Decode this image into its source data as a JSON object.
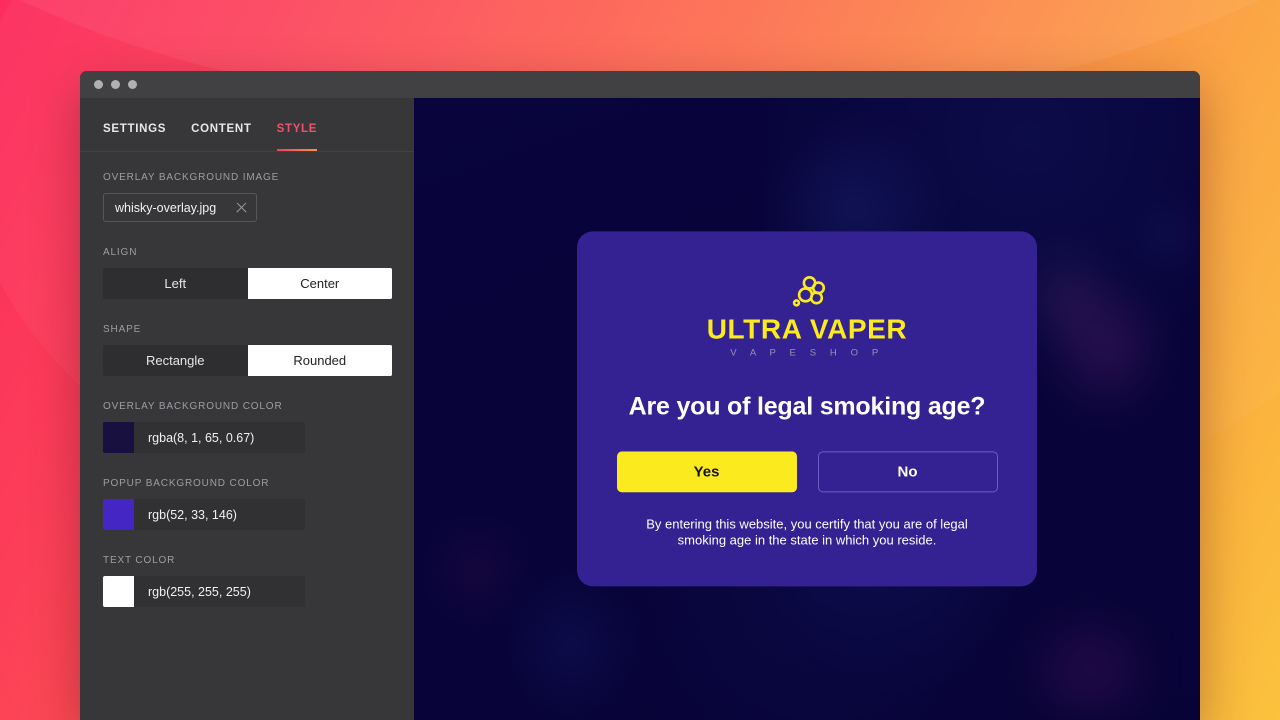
{
  "window": {
    "traffic_lights": [
      "close",
      "minimize",
      "maximize"
    ]
  },
  "editor": {
    "tabs": [
      {
        "label": "SETTINGS",
        "active": false
      },
      {
        "label": "CONTENT",
        "active": false
      },
      {
        "label": "STYLE",
        "active": true
      }
    ],
    "accent_color": "#f0516b",
    "fields": {
      "overlay_background_image": {
        "label": "OVERLAY BACKGROUND IMAGE",
        "value": "whisky-overlay.jpg",
        "clear_icon": "close-icon"
      },
      "align": {
        "label": "ALIGN",
        "options": [
          "Left",
          "Center"
        ],
        "selected": "Center"
      },
      "shape": {
        "label": "SHAPE",
        "options": [
          "Rectangle",
          "Rounded"
        ],
        "selected": "Rounded"
      },
      "overlay_background_color": {
        "label": "OVERLAY BACKGROUND COLOR",
        "value": "rgba(8, 1, 65, 0.67)",
        "swatch": "#18103f"
      },
      "popup_background_color": {
        "label": "POPUP BACKGROUND COLOR",
        "value": "rgb(52, 33, 146)",
        "swatch": "#342192"
      },
      "text_color": {
        "label": "TEXT COLOR",
        "value": "rgb(255, 255, 255)",
        "swatch": "#ffffff"
      }
    }
  },
  "preview": {
    "popup": {
      "logo": {
        "icon": "smoke-cloud-icon",
        "title": "ULTRA VAPER",
        "subtitle": "V A P E S H O P",
        "title_color": "#FBEB1E",
        "subtitle_color": "#9a93b5"
      },
      "heading": "Are you of legal smoking age?",
      "buttons": [
        {
          "label": "Yes",
          "style": "primary"
        },
        {
          "label": "No",
          "style": "outline"
        }
      ],
      "disclaimer": "By entering this website, you certify that you are of legal smoking age in the state in which you reside.",
      "background_color": "rgb(52, 33, 146)"
    }
  }
}
